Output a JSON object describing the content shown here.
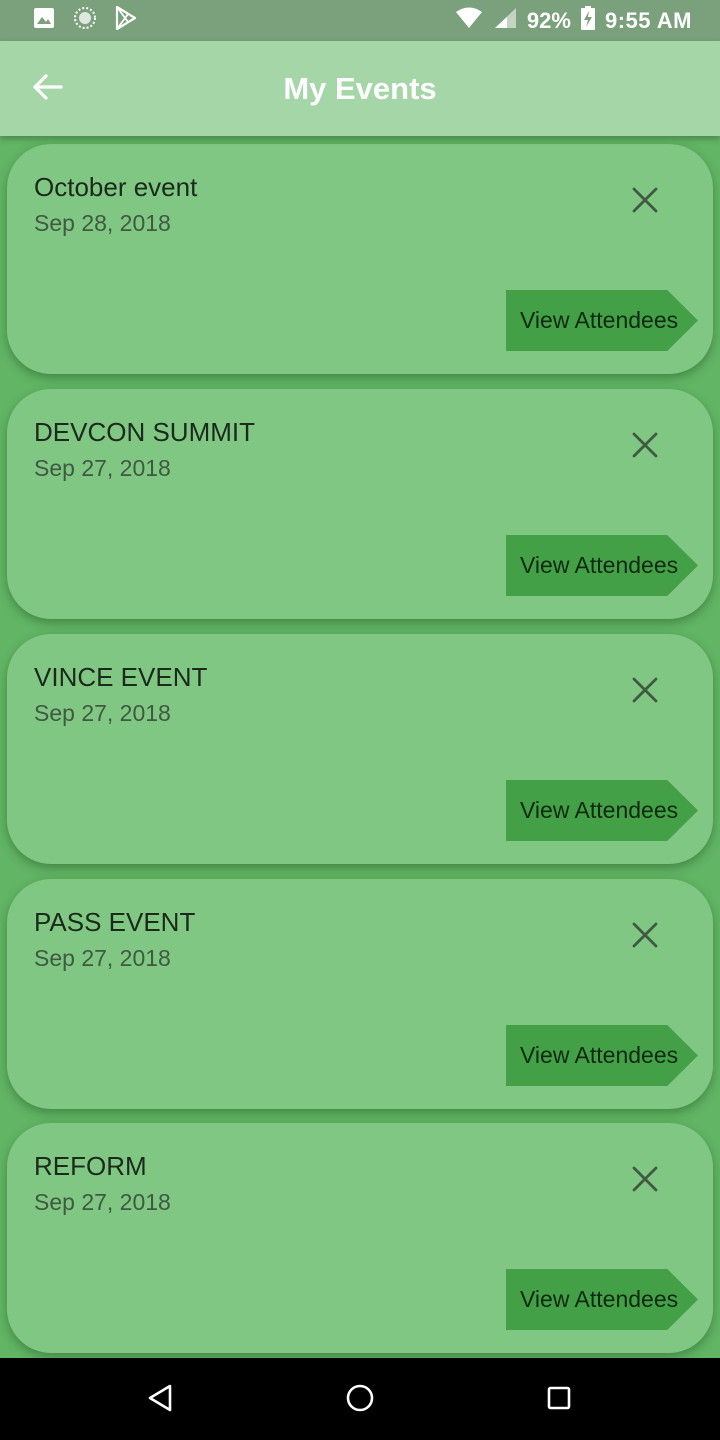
{
  "status_bar": {
    "battery": "92%",
    "time": "9:55 AM",
    "icons": [
      "image-icon",
      "sync-icon",
      "play-store-icon",
      "wifi-icon",
      "signal-icon",
      "battery-charging-icon"
    ]
  },
  "app_bar": {
    "title": "My Events",
    "back_icon": "arrow-back-icon"
  },
  "events": [
    {
      "title": "October event",
      "date": "Sep 28, 2018",
      "button_label": "View Attendees"
    },
    {
      "title": "DEVCON SUMMIT",
      "date": "Sep 27, 2018",
      "button_label": "View Attendees"
    },
    {
      "title": "VINCE EVENT",
      "date": "Sep 27, 2018",
      "button_label": "View Attendees"
    },
    {
      "title": "PASS EVENT",
      "date": "Sep 27, 2018",
      "button_label": "View Attendees"
    },
    {
      "title": "REFORM",
      "date": "Sep 27, 2018",
      "button_label": "View Attendees"
    }
  ],
  "nav_bar": {
    "icons": [
      "back-triangle-icon",
      "home-circle-icon",
      "recents-square-icon"
    ]
  },
  "colors": {
    "app_bar": "#a5d6a7",
    "card": "#81c784",
    "button": "#43a047",
    "list_background": "#62b565"
  }
}
